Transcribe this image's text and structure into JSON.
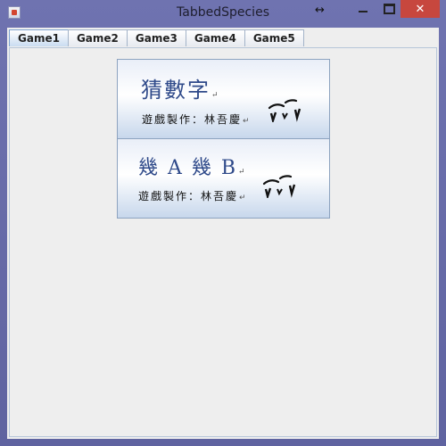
{
  "window": {
    "title": "TabbedSpecies",
    "resize_glyph": "↔",
    "close_glyph": "✕"
  },
  "tabs": [
    {
      "label": "Game1",
      "active": true
    },
    {
      "label": "Game2",
      "active": false
    },
    {
      "label": "Game3",
      "active": false
    },
    {
      "label": "Game4",
      "active": false
    },
    {
      "label": "Game5",
      "active": false
    }
  ],
  "cards": [
    {
      "title": "猜數字",
      "credit": "遊戲製作：林吾慶",
      "mark": "↵",
      "signature": "signature-graphic"
    },
    {
      "title": "幾 A 幾 B",
      "credit": "遊戲製作：林吾慶",
      "mark": "↵",
      "signature": "signature-graphic"
    }
  ],
  "colors": {
    "titlebar": "#6f73b0",
    "close_button": "#c7473e",
    "card_title": "#2f4a8a",
    "tab_active": "#c9dcf1"
  }
}
